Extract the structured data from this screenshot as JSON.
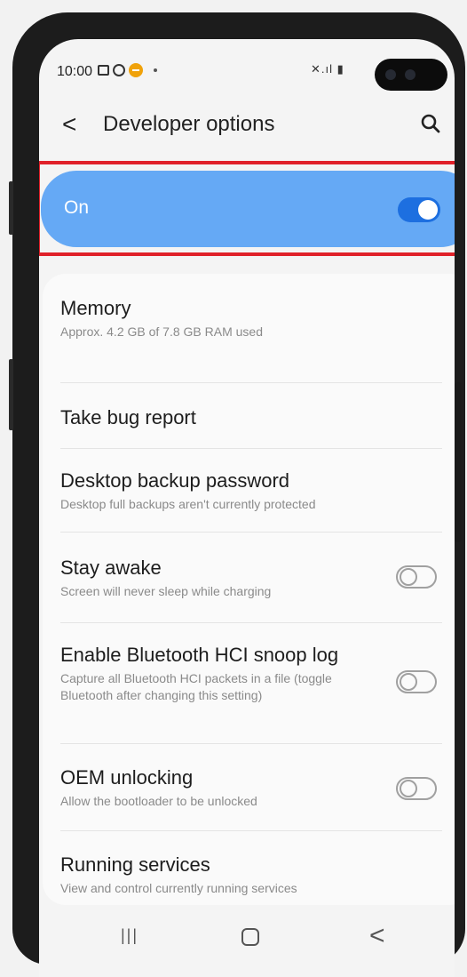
{
  "status_bar": {
    "time": "10:00",
    "icons_right_text": "✕.ıl ▮"
  },
  "app_bar": {
    "back_glyph": "<",
    "title": "Developer options"
  },
  "master_switch": {
    "label": "On",
    "state": "on",
    "accent": "#65a9f5",
    "toggle_color": "#1d6fe0"
  },
  "highlight_color": "#e0212a",
  "settings": [
    {
      "title": "Memory",
      "subtitle": "Approx. 4.2 GB of 7.8 GB RAM used",
      "has_toggle": false
    },
    {
      "title": "Take bug report",
      "subtitle": "",
      "has_toggle": false
    },
    {
      "title": "Desktop backup password",
      "subtitle": "Desktop full backups aren't currently protected",
      "has_toggle": false
    },
    {
      "title": "Stay awake",
      "subtitle": "Screen will never sleep while charging",
      "has_toggle": true,
      "state": "off"
    },
    {
      "title": "Enable Bluetooth HCI snoop log",
      "subtitle": "Capture all Bluetooth HCI packets in a file (toggle Bluetooth after changing this setting)",
      "has_toggle": true,
      "state": "off"
    },
    {
      "title": "OEM unlocking",
      "subtitle": "Allow the bootloader to be unlocked",
      "has_toggle": true,
      "state": "off"
    },
    {
      "title": "Running services",
      "subtitle": "View and control currently running services",
      "has_toggle": false
    }
  ],
  "nav_bar": {
    "recent_glyph": "|||",
    "back_glyph": "<"
  }
}
